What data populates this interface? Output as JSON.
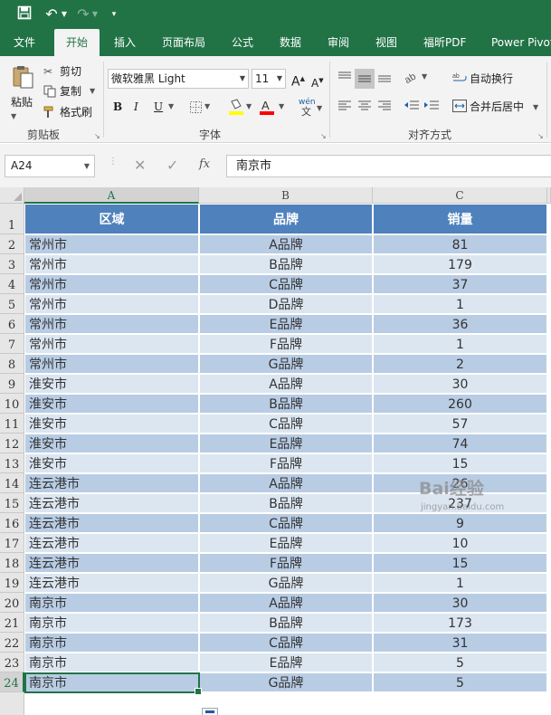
{
  "quick_access": {
    "save": "save",
    "undo": "undo",
    "redo": "redo",
    "more": "customize"
  },
  "tabs": [
    {
      "label": "文件",
      "active": false
    },
    {
      "label": "开始",
      "active": true
    },
    {
      "label": "插入",
      "active": false
    },
    {
      "label": "页面布局",
      "active": false
    },
    {
      "label": "公式",
      "active": false
    },
    {
      "label": "数据",
      "active": false
    },
    {
      "label": "审阅",
      "active": false
    },
    {
      "label": "视图",
      "active": false
    },
    {
      "label": "福昕PDF",
      "active": false
    },
    {
      "label": "Power Pivot",
      "active": false
    }
  ],
  "ribbon": {
    "clipboard": {
      "group_label": "剪贴板",
      "paste": "粘贴",
      "cut": "剪切",
      "copy": "复制",
      "format_painter": "格式刷"
    },
    "font": {
      "group_label": "字体",
      "font_name": "微软雅黑 Light",
      "font_size": "11",
      "grow": "A",
      "shrink": "A",
      "bold": "B",
      "italic": "I",
      "underline": "U",
      "phonetic": "wén"
    },
    "alignment": {
      "group_label": "对齐方式",
      "wrap_text": "自动换行",
      "merge_center": "合并后居中"
    }
  },
  "formula_bar": {
    "name_box": "A24",
    "fx": "fx",
    "formula": "南京市"
  },
  "grid": {
    "columns": [
      "A",
      "B",
      "C"
    ],
    "selected_column": "A",
    "selected_row": 24,
    "row_numbers": [
      1,
      2,
      3,
      4,
      5,
      6,
      7,
      8,
      9,
      10,
      11,
      12,
      13,
      14,
      15,
      16,
      17,
      18,
      19,
      20,
      21,
      22,
      23,
      24
    ],
    "header": [
      "区域",
      "品牌",
      "销量"
    ],
    "rows": [
      [
        "常州市",
        "A品牌",
        "81"
      ],
      [
        "常州市",
        "B品牌",
        "179"
      ],
      [
        "常州市",
        "C品牌",
        "37"
      ],
      [
        "常州市",
        "D品牌",
        "1"
      ],
      [
        "常州市",
        "E品牌",
        "36"
      ],
      [
        "常州市",
        "F品牌",
        "1"
      ],
      [
        "常州市",
        "G品牌",
        "2"
      ],
      [
        "淮安市",
        "A品牌",
        "30"
      ],
      [
        "淮安市",
        "B品牌",
        "260"
      ],
      [
        "淮安市",
        "C品牌",
        "57"
      ],
      [
        "淮安市",
        "E品牌",
        "74"
      ],
      [
        "淮安市",
        "F品牌",
        "15"
      ],
      [
        "连云港市",
        "A品牌",
        "26"
      ],
      [
        "连云港市",
        "B品牌",
        "237"
      ],
      [
        "连云港市",
        "C品牌",
        "9"
      ],
      [
        "连云港市",
        "E品牌",
        "10"
      ],
      [
        "连云港市",
        "F品牌",
        "15"
      ],
      [
        "连云港市",
        "G品牌",
        "1"
      ],
      [
        "南京市",
        "A品牌",
        "30"
      ],
      [
        "南京市",
        "B品牌",
        "173"
      ],
      [
        "南京市",
        "C品牌",
        "31"
      ],
      [
        "南京市",
        "E品牌",
        "5"
      ],
      [
        "南京市",
        "G品牌",
        "5"
      ]
    ]
  },
  "colors": {
    "excel_green": "#217346",
    "table_header": "#4f81bd",
    "band_dark": "#b8cce4",
    "band_light": "#dce6f1"
  },
  "watermark": {
    "brand": "Bai经验",
    "url": "jingyan.baidu.com"
  }
}
